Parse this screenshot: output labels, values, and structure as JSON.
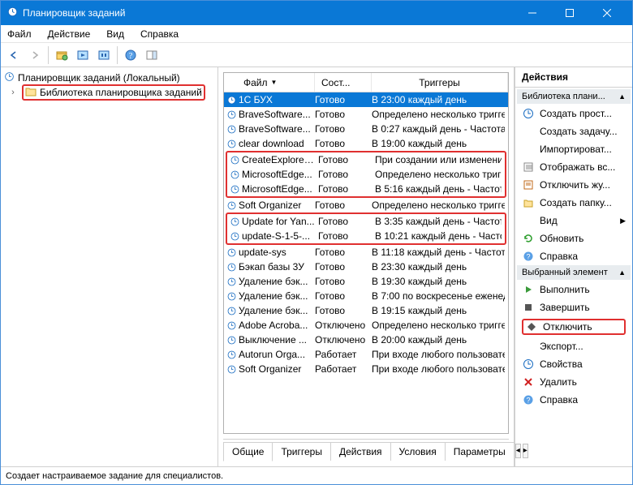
{
  "window": {
    "title": "Планировщик заданий"
  },
  "menu": {
    "file": "Файл",
    "action": "Действие",
    "view": "Вид",
    "help": "Справка"
  },
  "tree": {
    "root": "Планировщик заданий (Локальный)",
    "lib": "Библиотека планировщика заданий"
  },
  "list": {
    "headers": {
      "file": "Файл",
      "state": "Сост...",
      "trigger": "Триггеры"
    },
    "rows": [
      {
        "name": "1С БУХ",
        "state": "Готово",
        "trigger": "В 23:00 каждый день",
        "sel": true
      },
      {
        "name": "BraveSoftware...",
        "state": "Готово",
        "trigger": "Определено несколько тригге"
      },
      {
        "name": "BraveSoftware...",
        "state": "Готово",
        "trigger": "В 0:27 каждый день - Частота п"
      },
      {
        "name": "clear download",
        "state": "Готово",
        "trigger": "В 19:00 каждый день"
      },
      {
        "name": "CreateExplorer...",
        "state": "Готово",
        "trigger": "При создании или изменении"
      },
      {
        "name": "MicrosoftEdge...",
        "state": "Готово",
        "trigger": "Определено несколько тригге"
      },
      {
        "name": "MicrosoftEdge...",
        "state": "Готово",
        "trigger": "В 5:16 каждый день - Частота п"
      },
      {
        "name": "Soft Organizer",
        "state": "Готово",
        "trigger": "Определено несколько тригге"
      },
      {
        "name": "Update for Yan...",
        "state": "Готово",
        "trigger": "В 3:35 каждый день - Частота п"
      },
      {
        "name": "update-S-1-5-...",
        "state": "Готово",
        "trigger": "В 10:21 каждый день - Частота"
      },
      {
        "name": "update-sys",
        "state": "Готово",
        "trigger": "В 11:18 каждый день - Частота"
      },
      {
        "name": "Бэкап базы 3У",
        "state": "Готово",
        "trigger": "В 23:30 каждый день"
      },
      {
        "name": "Удаление бэк...",
        "state": "Готово",
        "trigger": "В 19:30 каждый день"
      },
      {
        "name": "Удаление бэк...",
        "state": "Готово",
        "trigger": "В 7:00 по воскресенье еженеде"
      },
      {
        "name": "Удаление бэк...",
        "state": "Готово",
        "trigger": "В 19:15 каждый день"
      },
      {
        "name": "Adobe Acroba...",
        "state": "Отключено",
        "trigger": "Определено несколько тригге"
      },
      {
        "name": "Выключение ...",
        "state": "Отключено",
        "trigger": "В 20:00 каждый день"
      },
      {
        "name": "Autorun Orga...",
        "state": "Работает",
        "trigger": "При входе любого пользовате"
      },
      {
        "name": "Soft Organizer",
        "state": "Работает",
        "trigger": "При входе любого пользовате"
      }
    ]
  },
  "tabs": {
    "general": "Общие",
    "triggers": "Триггеры",
    "actions": "Действия",
    "conditions": "Условия",
    "params": "Параметры"
  },
  "actions": {
    "title": "Действия",
    "sect1": "Библиотека плани...",
    "createBasic": "Создать прост...",
    "createTask": "Создать задачу...",
    "import": "Импортироват...",
    "showAll": "Отображать вс...",
    "disableLog": "Отключить жу...",
    "newFolder": "Создать папку...",
    "view": "Вид",
    "refresh": "Обновить",
    "help1": "Справка",
    "sect2": "Выбранный элемент",
    "run": "Выполнить",
    "end": "Завершить",
    "disable": "Отключить",
    "export": "Экспорт...",
    "props": "Свойства",
    "delete": "Удалить",
    "help2": "Справка"
  },
  "status": "Создает настраиваемое задание для специалистов."
}
